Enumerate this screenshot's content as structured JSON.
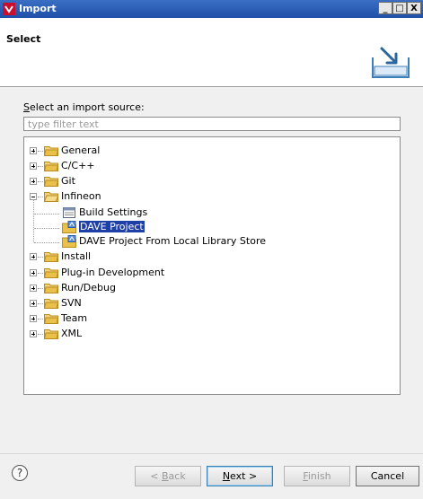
{
  "window": {
    "title": "Import",
    "minimize": "_",
    "maximize": "□",
    "close": "X"
  },
  "header": {
    "heading": "Select"
  },
  "body": {
    "source_label_accel": "S",
    "source_label_rest": "elect an import source:",
    "filter_placeholder": "type filter text",
    "filter_value": ""
  },
  "tree": {
    "general": "General",
    "cpp": "C/C++",
    "git": "Git",
    "infineon": "Infineon",
    "build_settings": "Build Settings",
    "dave_project": "DAVE Project",
    "dave_local": "DAVE Project From Local Library Store",
    "install": "Install",
    "plugin": "Plug-in Development",
    "rundebug": "Run/Debug",
    "svn": "SVN",
    "team": "Team",
    "xml": "XML"
  },
  "footer": {
    "help": "?",
    "back_pre": "< ",
    "back_accel": "B",
    "back_rest": "ack",
    "next_accel": "N",
    "next_rest": "ext >",
    "finish_accel": "F",
    "finish_rest": "inish",
    "cancel": "Cancel"
  },
  "colors": {
    "title_bar": "#1f4fa8",
    "selection": "#1e3fa6",
    "folder": "#e8c04a"
  }
}
